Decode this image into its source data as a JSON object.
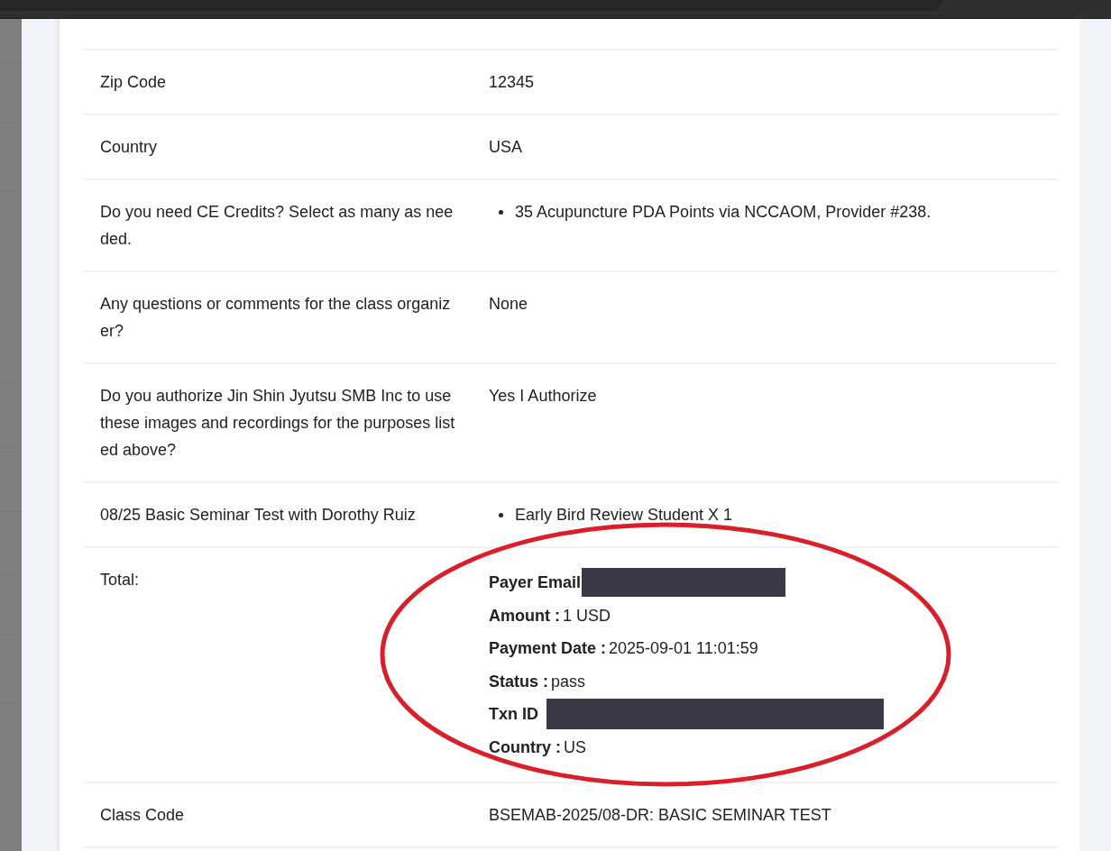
{
  "rows": [
    {
      "label": "Zip Code",
      "kind": "text",
      "value": "12345"
    },
    {
      "label": "Country",
      "kind": "text",
      "value": "USA"
    },
    {
      "label": "Do you need CE Credits? Select as many as needed.",
      "kind": "list",
      "items": [
        "35 Acupuncture PDA Points via NCCAOM, Provider #238."
      ]
    },
    {
      "label": "Any questions or comments for the class organizer?",
      "kind": "text",
      "value": "None"
    },
    {
      "label": "Do you authorize Jin Shin Jyutsu SMB Inc to use these images and recordings for the purposes listed above?",
      "kind": "text",
      "value": "Yes I Authorize"
    },
    {
      "label": "08/25 Basic Seminar Test with Dorothy Ruiz",
      "kind": "list",
      "items": [
        "Early Bird Review Student X 1"
      ]
    },
    {
      "label": "Total:",
      "kind": "payment",
      "circled": true,
      "fields": [
        {
          "name": "Payer Email",
          "redacted": true
        },
        {
          "name": "Amount :",
          "value": "1 USD"
        },
        {
          "name": "Payment Date :",
          "value": "2025-09-01 11:01:59"
        },
        {
          "name": "Status :",
          "value": "pass"
        },
        {
          "name": "Txn ID",
          "redacted": true
        },
        {
          "name": "Country :",
          "value": "US"
        }
      ]
    },
    {
      "label": "Class Code",
      "kind": "text",
      "value": "BSEMAB-2025/08-DR: BASIC SEMINAR TEST"
    }
  ]
}
